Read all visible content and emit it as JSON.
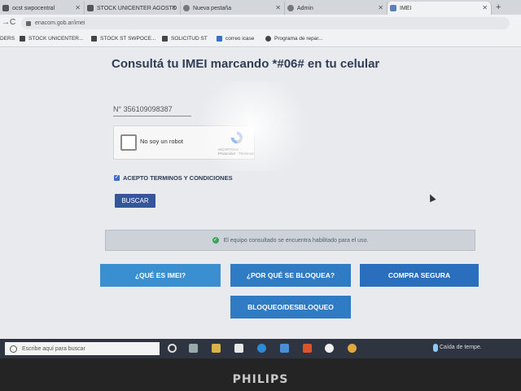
{
  "tabs": [
    {
      "label": "ocst swpocentral"
    },
    {
      "label": "STOCK UNICENTER AGOSTO"
    },
    {
      "label": "Nueva pestaña"
    },
    {
      "label": "Admin"
    },
    {
      "label": "IMEI"
    }
  ],
  "url": "enacom.gob.ar/imei",
  "bookmarks": [
    {
      "label": "DERS"
    },
    {
      "label": "STOCK UNICENTER..."
    },
    {
      "label": "STOCK ST SWPOCE..."
    },
    {
      "label": "SOLICITUD ST"
    },
    {
      "label": "correo icase"
    },
    {
      "label": "Programa de repar..."
    }
  ],
  "page": {
    "heading": "Consultá tu IMEI marcando *#06# en tu celular",
    "imei_value": "N° 356109098387",
    "recaptcha_label": "No soy un robot",
    "recaptcha_small": "reCAPTCHA · Privacidad · Términos",
    "terms_label": "ACEPTO TERMINOS Y CONDICIONES",
    "buscar_label": "BUSCAR",
    "status_message": "El equipo consultado se encuentra habilitado para el uso.",
    "buttons": {
      "que_es": "¿QUÉ ES IMEI?",
      "por_que": "¿POR QUÉ SE BLOQUEA?",
      "compra": "COMPRA SEGURA",
      "bloqueo": "BLOQUEO/DESBLOQUEO"
    }
  },
  "taskbar": {
    "search_placeholder": "Escribe aquí para buscar",
    "weather": "Caída de tempe."
  },
  "monitor_brand": "PHILIPS",
  "colors": {
    "heading": "#2f3d56",
    "primary_button": "#35579a",
    "light_blue_button": "#3a8fd0",
    "mid_blue_button": "#2f7bc4",
    "status_ok": "#3aa55c"
  }
}
